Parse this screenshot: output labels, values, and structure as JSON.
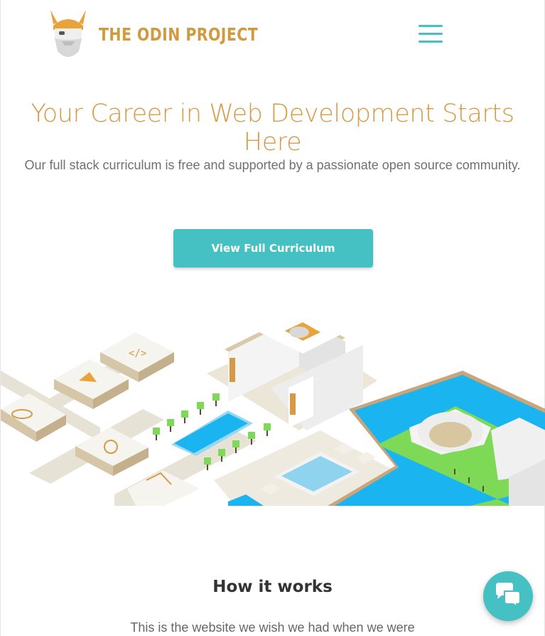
{
  "header": {
    "logo_text": "THE ODIN PROJECT",
    "logo_icon": "viking-head-icon",
    "menu_icon": "hamburger-menu-icon"
  },
  "hero": {
    "title": "Your Career in Web Development Starts Here",
    "subtitle": "Our full stack curriculum is free and supported by a passionate open source community.",
    "cta_label": "View Full Curriculum"
  },
  "how_it_works": {
    "title": "How it works",
    "text": "This is the website we wish we had when we were"
  },
  "chat": {
    "icon": "chat-bubbles-icon"
  },
  "colors": {
    "brand_gold": "#d59a45",
    "accent_teal": "#45c1c3",
    "water_blue": "#1ab4f0",
    "grass_green": "#7ed957"
  }
}
